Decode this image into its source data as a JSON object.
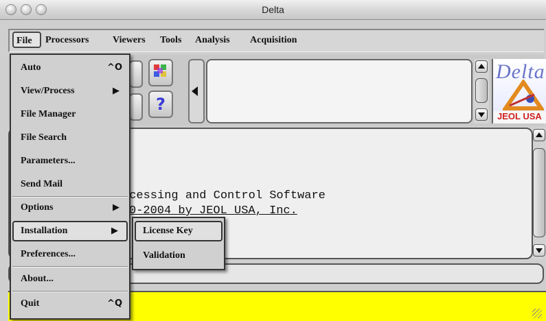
{
  "window": {
    "title": "Delta"
  },
  "menubar": {
    "items": [
      "File",
      "Processors",
      "Viewers",
      "Tools",
      "Analysis",
      "Acquisition"
    ]
  },
  "file_menu": {
    "items": [
      {
        "label": "Auto",
        "shortcut": "^O"
      },
      {
        "label": "View/Process",
        "submenu": true
      },
      {
        "label": "File Manager"
      },
      {
        "label": "File Search"
      },
      {
        "label": "Parameters..."
      },
      {
        "label": "Send Mail"
      },
      {
        "label": "Options",
        "submenu": true
      },
      {
        "label": "Installation",
        "submenu": true,
        "selected": true
      },
      {
        "label": "Preferences..."
      },
      {
        "label": "About..."
      },
      {
        "label": "Quit",
        "shortcut": "^Q"
      }
    ],
    "arrow_glyph": "▶"
  },
  "installation_submenu": {
    "items": [
      "License Key",
      "Validation"
    ]
  },
  "toolbar": {
    "help_glyph": "?"
  },
  "logo": {
    "text": "Delta",
    "brand": "JEOL USA"
  },
  "console": {
    "lines": [
      "ocessing and Control Software",
      "0-2004 by JEOL USA, Inc."
    ]
  },
  "colors": {
    "status_yellow": "#ffff00",
    "logo_blue": "#6a74c8",
    "jeol_red": "#cf1f1f"
  }
}
